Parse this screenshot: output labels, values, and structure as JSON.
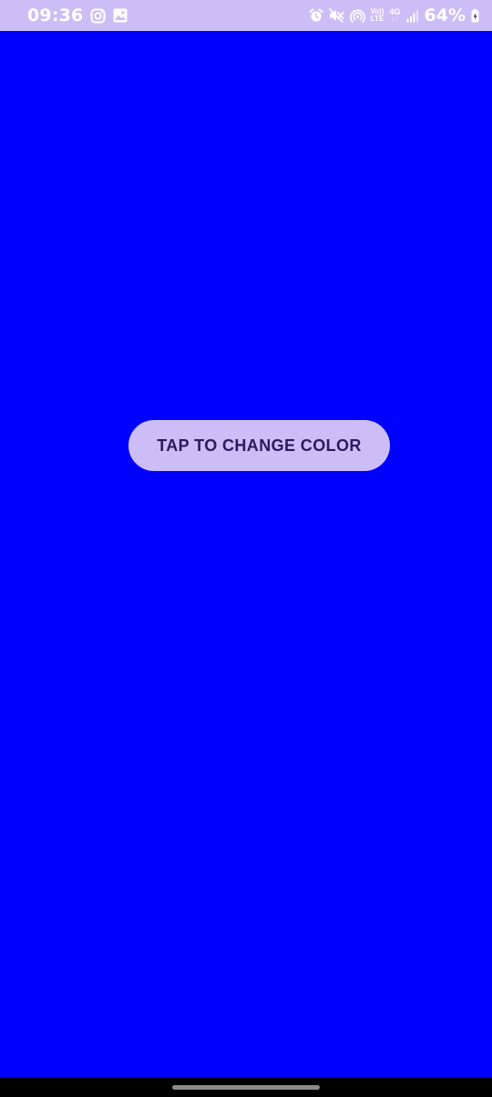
{
  "status_bar": {
    "time": "09:36",
    "volte_line1": "Vo))",
    "volte_line2": "LTE",
    "network_type": "4G",
    "network_arrows": "↓↑",
    "battery_percent": "64%",
    "left_icons": [
      "instagram-icon",
      "image-icon"
    ],
    "right_icons": [
      "alarm-icon",
      "mute-icon",
      "hotspot-icon",
      "volte-indicator",
      "network-4g-indicator",
      "signal-icon",
      "battery-icon"
    ]
  },
  "main": {
    "background_color": "#0000ff",
    "button_label": "TAP TO CHANGE COLOR",
    "button_color": "#cdbdf6",
    "button_text_color": "#2a1a5e"
  },
  "colors": {
    "status_bar": "#cdbdf6",
    "nav_bar": "#000000",
    "nav_handle": "#8a8a8a"
  }
}
